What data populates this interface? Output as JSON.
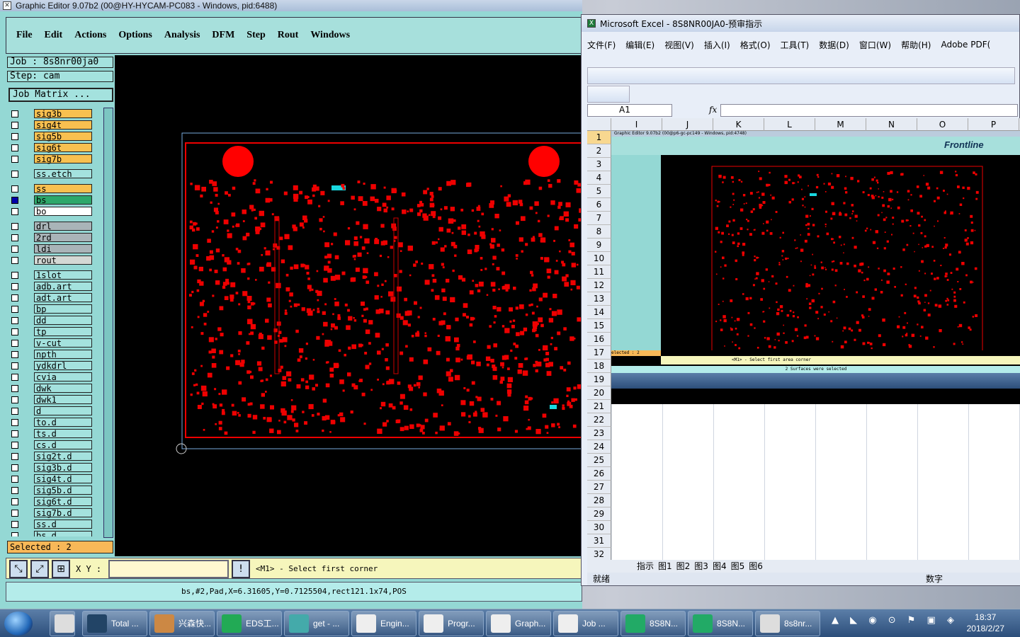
{
  "ge": {
    "title": "Graphic Editor 9.07b2 (00@HY-HYCAM-PC083 - Windows, pid:6488)",
    "menu": [
      "File",
      "Edit",
      "Actions",
      "Options",
      "Analysis",
      "DFM",
      "Step",
      "Rout",
      "Windows"
    ],
    "job": "Job : 8s8nr00ja0",
    "step": "Step: cam",
    "job_matrix": "Job Matrix ...",
    "layers": [
      {
        "name": "sig3b",
        "color": "#f8c050"
      },
      {
        "name": "sig4t",
        "color": "#f8c050"
      },
      {
        "name": "sig5b",
        "color": "#f8c050"
      },
      {
        "name": "sig6t",
        "color": "#f8c050"
      },
      {
        "name": "sig7b",
        "color": "#f8c050"
      },
      {
        "name": "ss.etch",
        "color": "#a4e2de"
      },
      {
        "name": "ss",
        "color": "#f8c050"
      },
      {
        "name": "bs",
        "color": "#2ea86a",
        "checked": true
      },
      {
        "name": "bo",
        "color": "#ffffff"
      },
      {
        "name": "drl",
        "color": "#a9b4b8"
      },
      {
        "name": "2rd",
        "color": "#a9b4b8"
      },
      {
        "name": "ldi",
        "color": "#a9b4b8"
      },
      {
        "name": "rout",
        "color": "#d4d8d4"
      },
      {
        "name": "1slot",
        "color": "#a4e2de"
      },
      {
        "name": "adb.art",
        "color": "#a4e2de"
      },
      {
        "name": "adt.art",
        "color": "#a4e2de"
      },
      {
        "name": "bp",
        "color": "#a4e2de"
      },
      {
        "name": "dd",
        "color": "#a4e2de"
      },
      {
        "name": "tp",
        "color": "#a4e2de"
      },
      {
        "name": "v-cut",
        "color": "#a4e2de"
      },
      {
        "name": "npth",
        "color": "#a4e2de"
      },
      {
        "name": "ydkdrl",
        "color": "#a4e2de"
      },
      {
        "name": "cvia",
        "color": "#a4e2de"
      },
      {
        "name": "dwk",
        "color": "#a4e2de"
      },
      {
        "name": "dwk1",
        "color": "#a4e2de"
      },
      {
        "name": "d",
        "color": "#a4e2de"
      },
      {
        "name": "to.d",
        "color": "#a4e2de"
      },
      {
        "name": "ts.d",
        "color": "#a4e2de"
      },
      {
        "name": "cs.d",
        "color": "#a4e2de"
      },
      {
        "name": "sig2t.d",
        "color": "#a4e2de"
      },
      {
        "name": "sig3b.d",
        "color": "#a4e2de"
      },
      {
        "name": "sig4t.d",
        "color": "#a4e2de"
      },
      {
        "name": "sig5b.d",
        "color": "#a4e2de"
      },
      {
        "name": "sig6t.d",
        "color": "#a4e2de"
      },
      {
        "name": "sig7b.d",
        "color": "#a4e2de"
      },
      {
        "name": "ss.d",
        "color": "#a4e2de"
      },
      {
        "name": "bs.d",
        "color": "#a4e2de"
      }
    ],
    "selected": "Selected : 2",
    "xy_label": "X Y :",
    "prompt": "<M1> - Select first corner",
    "status": "bs,#2,Pad,X=6.31605,Y=0.7125504,rect121.1x74,POS"
  },
  "xl": {
    "title": "Microsoft Excel - 8S8NR00JA0-预审指示",
    "menu": [
      "文件(F)",
      "编辑(E)",
      "视图(V)",
      "插入(I)",
      "格式(O)",
      "工具(T)",
      "数据(D)",
      "窗口(W)",
      "帮助(H)",
      "Adobe PDF("
    ],
    "namebox": "A1",
    "fx": "fx",
    "columns": [
      "I",
      "J",
      "K",
      "L",
      "M",
      "N",
      "O",
      "P"
    ],
    "rows": [
      "1",
      "2",
      "3",
      "4",
      "5",
      "6",
      "7",
      "8",
      "9",
      "10",
      "11",
      "12",
      "13",
      "14",
      "15",
      "16",
      "17",
      "18",
      "19",
      "20",
      "21",
      "22",
      "23",
      "24",
      "25",
      "26",
      "27",
      "28",
      "29",
      "30",
      "31",
      "32"
    ],
    "tabs": [
      "指示",
      "图1",
      "图2",
      "图3",
      "图4",
      "图5",
      "图6"
    ],
    "status": "就绪",
    "numlock": "数字",
    "embed_title": "Graphic Editor 9.07b2 (00@p6-gc-pc149 - Windows, pid:4748)",
    "embed_status": "2 Surfaces were selected",
    "embed_selected": "elected : 2",
    "embed_prompt": "<M1> - Select first area corner",
    "frontline": "Frontline"
  },
  "taskbar": {
    "items": [
      "Total ...",
      "兴森快...",
      "EDS工...",
      "get - ...",
      "Engin...",
      "Progr...",
      "Graph...",
      "Job ...",
      "8S8N...",
      "8S8N...",
      "8s8nr..."
    ],
    "time": "18:37",
    "date": "2018/2/27"
  }
}
